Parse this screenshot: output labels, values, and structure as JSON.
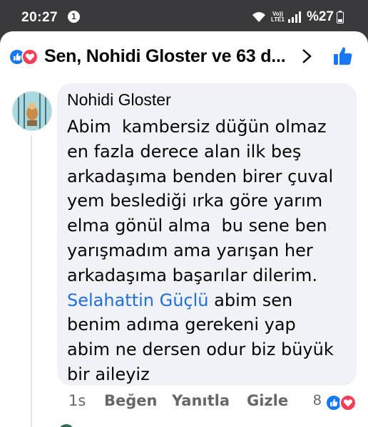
{
  "status_bar": {
    "time": "20:27",
    "notification_count": "1",
    "volte_line1": "Vo))",
    "volte_line2": "LTE1",
    "battery": "%27"
  },
  "reactions_header": {
    "title": "Sen, Nohidi Gloster ve 63 d...",
    "icons": [
      "like-reaction-icon",
      "love-reaction-icon",
      "chevron-right-icon",
      "thumbs-up-icon"
    ]
  },
  "comment": {
    "author": "Nohidi Gloster",
    "lines": [
      "Abim  kambersiz düğün olmaz",
      "en fazla derece alan ilk beş",
      "arkadaşıma benden birer çuval",
      "yem beslediği ırka göre yarım",
      "elma gönül alma  bu sene ben",
      "yarışmadım ama yarışan her",
      "arkadaşıma başarılar dilerim."
    ],
    "mention": "Selahattin Güçlü",
    "mention_rest": " abim sen",
    "lines_after": [
      "benim adıma gerekeni yap",
      "abim ne dersen odur biz büyük",
      "bir aileyiz"
    ]
  },
  "actions": {
    "time_ago": "1s",
    "like": "Beğen",
    "reply": "Yanıtla",
    "hide": "Gizle",
    "reaction_count": "8"
  },
  "colors": {
    "like_blue": "#1877f2",
    "love_red": "#f33e58",
    "mention_blue": "#216fdb",
    "bubble_bg": "#f0f2f5",
    "status_bg": "#3a3a3c"
  }
}
